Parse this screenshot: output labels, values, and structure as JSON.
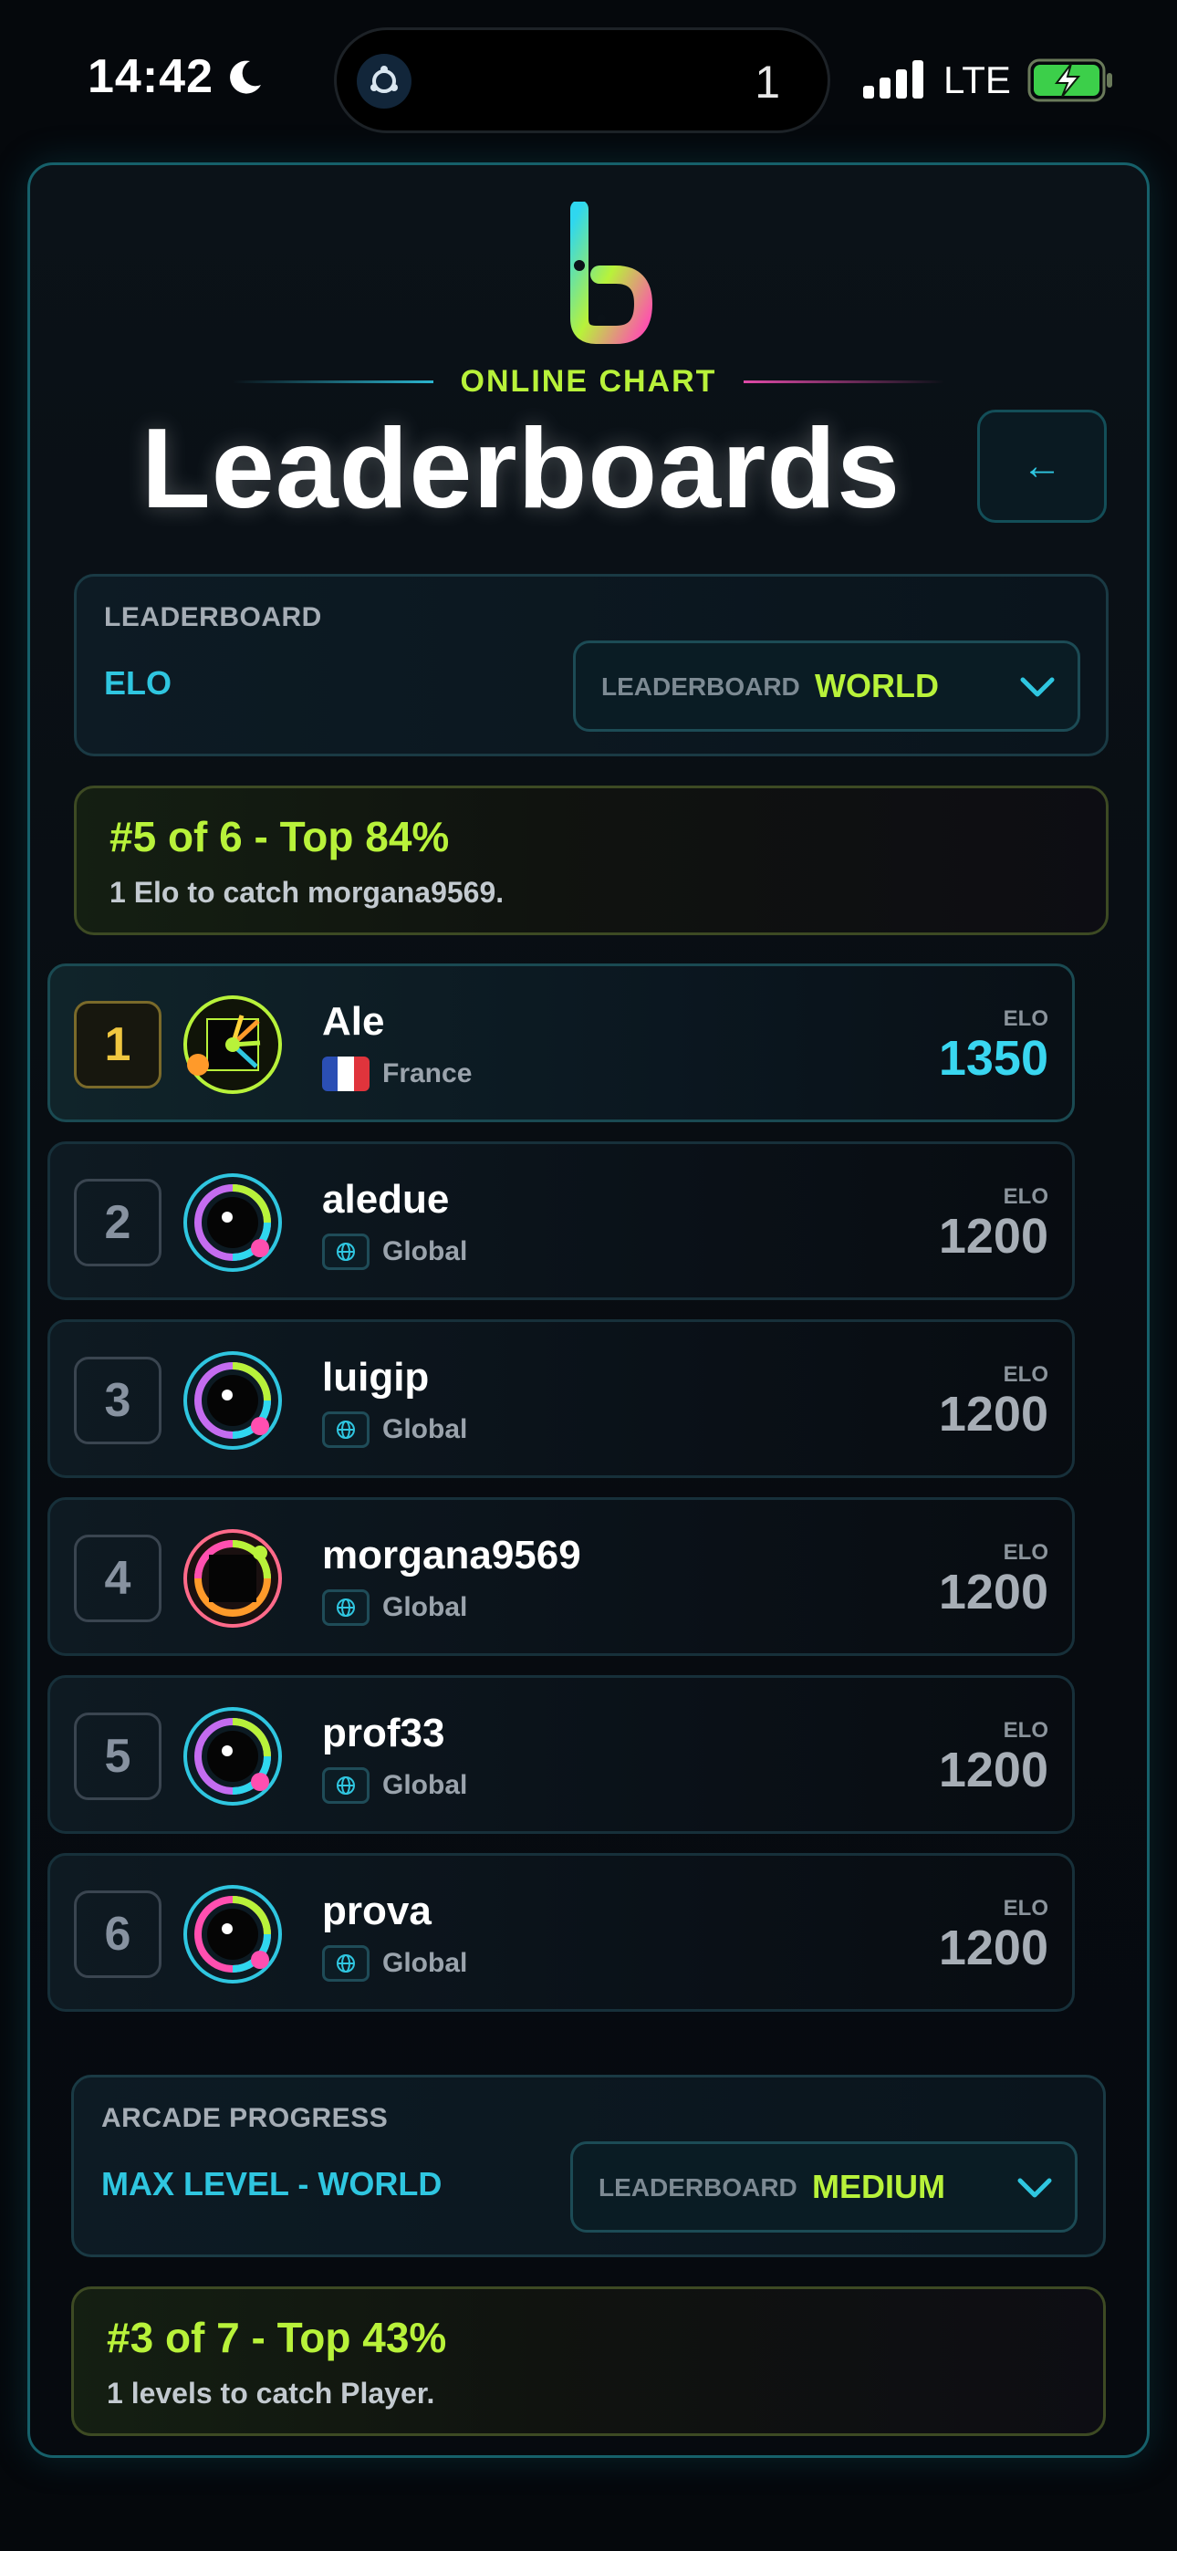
{
  "status_bar": {
    "time": "14:42",
    "island_count": "1",
    "network": "LTE"
  },
  "header": {
    "tagline": "ONLINE CHART",
    "title": "Leaderboards",
    "back_label": "←"
  },
  "leaderboard_selector": {
    "heading": "LEADERBOARD",
    "value": "ELO",
    "dropdown_label": "LEADERBOARD",
    "dropdown_value": "WORLD"
  },
  "leaderboard_rank": {
    "title": "#5 of 6 - Top 84%",
    "subtitle": "1 Elo to catch morgana9569."
  },
  "players": [
    {
      "rank": "1",
      "name": "Ale",
      "region": "France",
      "elo_label": "ELO",
      "elo": "1350"
    },
    {
      "rank": "2",
      "name": "aledue",
      "region": "Global",
      "elo_label": "ELO",
      "elo": "1200"
    },
    {
      "rank": "3",
      "name": "luigip",
      "region": "Global",
      "elo_label": "ELO",
      "elo": "1200"
    },
    {
      "rank": "4",
      "name": "morgana9569",
      "region": "Global",
      "elo_label": "ELO",
      "elo": "1200"
    },
    {
      "rank": "5",
      "name": "prof33",
      "region": "Global",
      "elo_label": "ELO",
      "elo": "1200"
    },
    {
      "rank": "6",
      "name": "prova",
      "region": "Global",
      "elo_label": "ELO",
      "elo": "1200"
    }
  ],
  "arcade_selector": {
    "heading": "ARCADE PROGRESS",
    "value": "MAX LEVEL - WORLD",
    "dropdown_label": "LEADERBOARD",
    "dropdown_value": "MEDIUM"
  },
  "arcade_rank": {
    "title": "#3 of 7 - Top 43%",
    "subtitle": "1 levels to catch Player."
  },
  "colors": {
    "accent_cyan": "#2fc6e0",
    "accent_lime": "#b8f23a",
    "accent_pink": "#e04aa8",
    "background": "#05080c"
  }
}
